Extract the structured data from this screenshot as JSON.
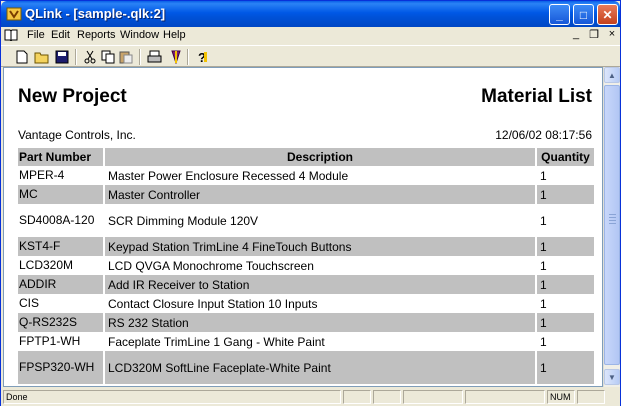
{
  "window": {
    "title": "QLink - [sample-.qlk:2]"
  },
  "titlebar_buttons": {
    "minimize": "_",
    "maximize": "□",
    "close": "✕"
  },
  "menu": {
    "items": [
      "File",
      "Edit",
      "Reports",
      "Window",
      "Help"
    ],
    "controls": {
      "minimize": "_",
      "restore": "❐",
      "close": "×"
    }
  },
  "toolbar": {
    "icons": [
      "new-document-icon",
      "open-folder-icon",
      "save-icon",
      "cut-icon",
      "copy-icon",
      "paste-icon",
      "print-icon",
      "report-icon",
      "help-icon"
    ]
  },
  "report": {
    "project_name": "New Project",
    "report_type": "Material List",
    "company": "Vantage Controls, Inc.",
    "datetime": "12/06/02 08:17:56",
    "columns": [
      "Part Number",
      "Description",
      "Quantity"
    ],
    "rows": [
      {
        "part": "MPER-4",
        "description": "Master Power Enclosure Recessed 4 Module",
        "qty": "1"
      },
      {
        "part": "MC",
        "description": "Master Controller",
        "qty": "1"
      },
      {
        "part": "SD4008A-120",
        "description": "SCR Dimming Module 120V",
        "qty": "1"
      },
      {
        "part": "KST4-F",
        "description": "Keypad Station TrimLine 4 FineTouch Buttons",
        "qty": "1"
      },
      {
        "part": "LCD320M",
        "description": "LCD QVGA Monochrome Touchscreen",
        "qty": "1"
      },
      {
        "part": "ADDIR",
        "description": "Add IR Receiver to Station",
        "qty": "1"
      },
      {
        "part": "CIS",
        "description": "Contact Closure Input Station 10 Inputs",
        "qty": "1"
      },
      {
        "part": "Q-RS232S",
        "description": "RS 232 Station",
        "qty": "1"
      },
      {
        "part": "FPTP1-WH",
        "description": "Faceplate TrimLine 1 Gang - White Paint",
        "qty": "1"
      },
      {
        "part": "FPSP320-WH",
        "description": "LCD320M SoftLine Faceplate-White Paint",
        "qty": "1"
      }
    ]
  },
  "status": {
    "text": "Done",
    "num": "NUM"
  },
  "colors": {
    "titlebar": "#0058e6",
    "row_alt": "#c0c0c0",
    "header": "#c0c0c0"
  }
}
